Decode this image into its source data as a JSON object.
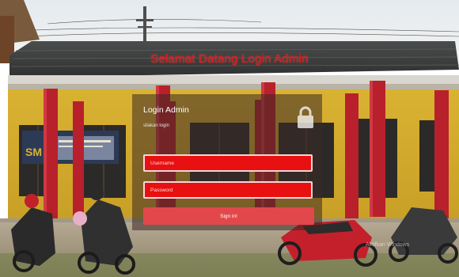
{
  "page": {
    "title": "Selamat Datang Login Admin"
  },
  "login": {
    "heading": "Login Admin",
    "subtitle": "silakan login",
    "username_placeholder": "Username",
    "password_placeholder": "Password",
    "signin_label": "Sign in!"
  },
  "background": {
    "sign_text": "SM",
    "watermark": "Aktifkan Windows"
  },
  "colors": {
    "title": "#e21a1a",
    "field": "#e81010",
    "button": "#e2484b"
  },
  "icons": {
    "lock": "lock-icon"
  }
}
